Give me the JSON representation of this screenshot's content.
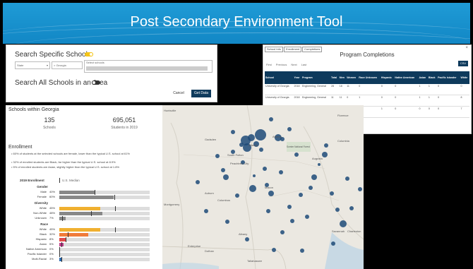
{
  "title": "Post Secondary Environment Tool",
  "search": {
    "specific_label": "Search Specific Schools",
    "state_select": "State",
    "state_chip": "× Georgia",
    "schools_placeholder": "Select schools",
    "all_label": "Search All Schools in an Area",
    "cancel": "Cancel",
    "get_data": "Get Data"
  },
  "completions": {
    "tabs": [
      "School Info",
      "Enrollment",
      "Completions"
    ],
    "title": "Program Completions",
    "controls": [
      "First",
      "Previous",
      "Next",
      "Last"
    ],
    "csv": "CSV",
    "close": "×",
    "headers": [
      "School",
      "Year",
      "Program",
      "Total",
      "Men",
      "Women",
      "Race Unknown",
      "Hispanic",
      "Native American",
      "Asian",
      "Black",
      "Pacific Islander",
      "White"
    ],
    "rows": [
      [
        "University of Georgia",
        "2018",
        "Engineering, General",
        "28",
        "18",
        "11",
        "0",
        "0",
        "0",
        "1",
        "1",
        "0",
        "0"
      ],
      [
        "University of Georgia",
        "2018",
        "Engineering, General",
        "11",
        "11",
        "0",
        "1",
        "0",
        "0",
        "1",
        "1",
        "0",
        "8"
      ],
      [
        "University of Georgia",
        "2017",
        "Engineering, General",
        "18",
        "10",
        "3",
        "0",
        "1",
        "0",
        "0",
        "0",
        "0",
        "7"
      ]
    ]
  },
  "stats": {
    "heading": "Schools within Georgia",
    "schools_count": "135",
    "schools_label": "Schools",
    "students_count": "695,051",
    "students_label": "Students in 2019"
  },
  "enrollment": {
    "heading": "Enrollment",
    "bullets": [
      "• 60% of students at the selected schools are female, lower than the typical U.S. school at 61%",
      "• 32% of enrolled students are Black, far higher than the typical U.S. school at 8.9%",
      "• 5% of enrolled students are Asian, slightly higher than the typical U.S. school at 1.8%"
    ],
    "legend_title": "2019 Enrollment",
    "legend_median": "U.S. Median",
    "groups": [
      {
        "name": "Gender",
        "rows": [
          {
            "label": "Male",
            "pct": "40%",
            "value": 40,
            "median": 39,
            "color": "#888888"
          },
          {
            "label": "Female",
            "pct": "60%",
            "value": 60,
            "median": 61,
            "color": "#888888"
          }
        ]
      },
      {
        "name": "Diversity",
        "rows": [
          {
            "label": "White",
            "pct": "45%",
            "value": 45,
            "median": 62,
            "color": "#f0b030"
          },
          {
            "label": "Non-White",
            "pct": "48%",
            "value": 48,
            "median": 35,
            "color": "#888888"
          },
          {
            "label": "Unknown",
            "pct": "7%",
            "value": 7,
            "median": 3,
            "color": "#888888"
          }
        ]
      },
      {
        "name": "Race",
        "rows": [
          {
            "label": "White",
            "pct": "45%",
            "value": 45,
            "median": 62,
            "color": "#f0b030"
          },
          {
            "label": "Black",
            "pct": "32%",
            "value": 32,
            "median": 9,
            "color": "#f07c3a"
          },
          {
            "label": "Hispanic",
            "pct": "8%",
            "value": 8,
            "median": 7,
            "color": "#e04a4a"
          },
          {
            "label": "Asian",
            "pct": "5%",
            "value": 5,
            "median": 2,
            "color": "#c03c8a"
          },
          {
            "label": "Native American",
            "pct": "0%",
            "value": 0,
            "median": 0,
            "color": "#6a3c9a"
          },
          {
            "label": "Pacific Islander",
            "pct": "0%",
            "value": 0,
            "median": 0,
            "color": "#3c5aa0"
          },
          {
            "label": "Multi-Racial",
            "pct": "3%",
            "value": 3,
            "median": 2,
            "color": "#2a6ab0"
          }
        ]
      }
    ]
  },
  "map": {
    "cities": [
      "Huntsville",
      "Gadsden",
      "South Fulton",
      "Peachtree City",
      "Montgomery",
      "Auburn",
      "Columbus",
      "Macon",
      "Augusta",
      "Savannah",
      "Columbia",
      "Enterprise",
      "Dothan",
      "Tallahassee",
      "Charleston",
      "Sumter National Forest",
      "Florence",
      "Albany",
      "Athens",
      "Atlanta"
    ]
  }
}
